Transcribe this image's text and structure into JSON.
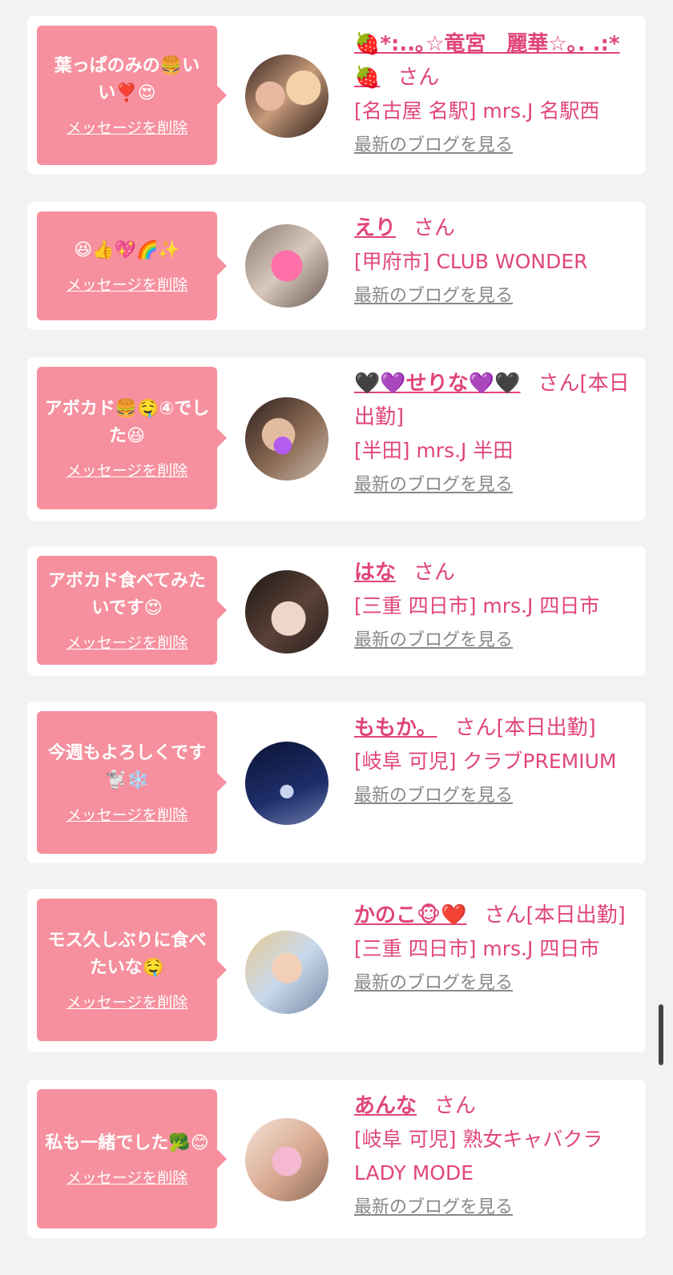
{
  "entries": [
    {
      "message": "葉っぱのみの🍔いい❣️😍",
      "delete_label": "メッセージを削除",
      "name_html_text": "🍓*:..｡☆竜宮　麗華☆｡. .:*🍓",
      "san": "さん",
      "status": "",
      "shop": "[名古屋 名駅] mrs.J 名駅西",
      "blog_label": "最新のブログを見る",
      "avatar": "two-women-selfie"
    },
    {
      "message": "😆👍💖🌈✨",
      "delete_label": "メッセージを削除",
      "name_html_text": "えり",
      "san": "さん",
      "status": "",
      "shop": "[甲府市] CLUB WONDER",
      "blog_label": "最新のブログを見る",
      "avatar": "pink-heart-sticker"
    },
    {
      "message": "アボカド🍔🤤④でした😆",
      "delete_label": "メッセージを削除",
      "name_html_text": "🖤💜せりな💜🖤",
      "san": "さん",
      "status": "[本日出勤]",
      "shop": "[半田] mrs.J 半田",
      "blog_label": "最新のブログを見る",
      "avatar": "woman-purple-heart"
    },
    {
      "message": "アボカド食べてみたいです😍",
      "delete_label": "メッセージを削除",
      "name_html_text": "はな",
      "san": "さん",
      "status": "",
      "shop": "[三重 四日市] mrs.J 四日市",
      "blog_label": "最新のブログを見る",
      "avatar": "woman-portrait"
    },
    {
      "message": "今週もよろしくです🐩❄️",
      "delete_label": "メッセージを削除",
      "name_html_text": "ももか。",
      "san": "さん",
      "status": "[本日出勤]",
      "shop": "[岐阜 可児] クラブPREMIUM",
      "blog_label": "最新のブログを見る",
      "avatar": "snowy-night"
    },
    {
      "message": "モス久しぶりに食べたいな🤤",
      "delete_label": "メッセージを削除",
      "name_html_text": "かのこ🐵❤️",
      "san": "さん",
      "status": "[本日出勤]",
      "shop": "[三重 四日市] mrs.J 四日市",
      "blog_label": "最新のブログを見る",
      "avatar": "blonde-woman"
    },
    {
      "message": "私も一緒でした🥦😊",
      "delete_label": "メッセージを削除",
      "name_html_text": "あんな",
      "san": "さん",
      "status": "",
      "shop": "[岐阜 可児] 熟女キャバクラLADY MODE",
      "blog_label": "最新のブログを見る",
      "avatar": "heart-glass"
    }
  ],
  "colors": {
    "accent": "#e0457b",
    "bubble": "#f6909e",
    "blog_link": "#888888",
    "background": "#f2f2f2"
  }
}
